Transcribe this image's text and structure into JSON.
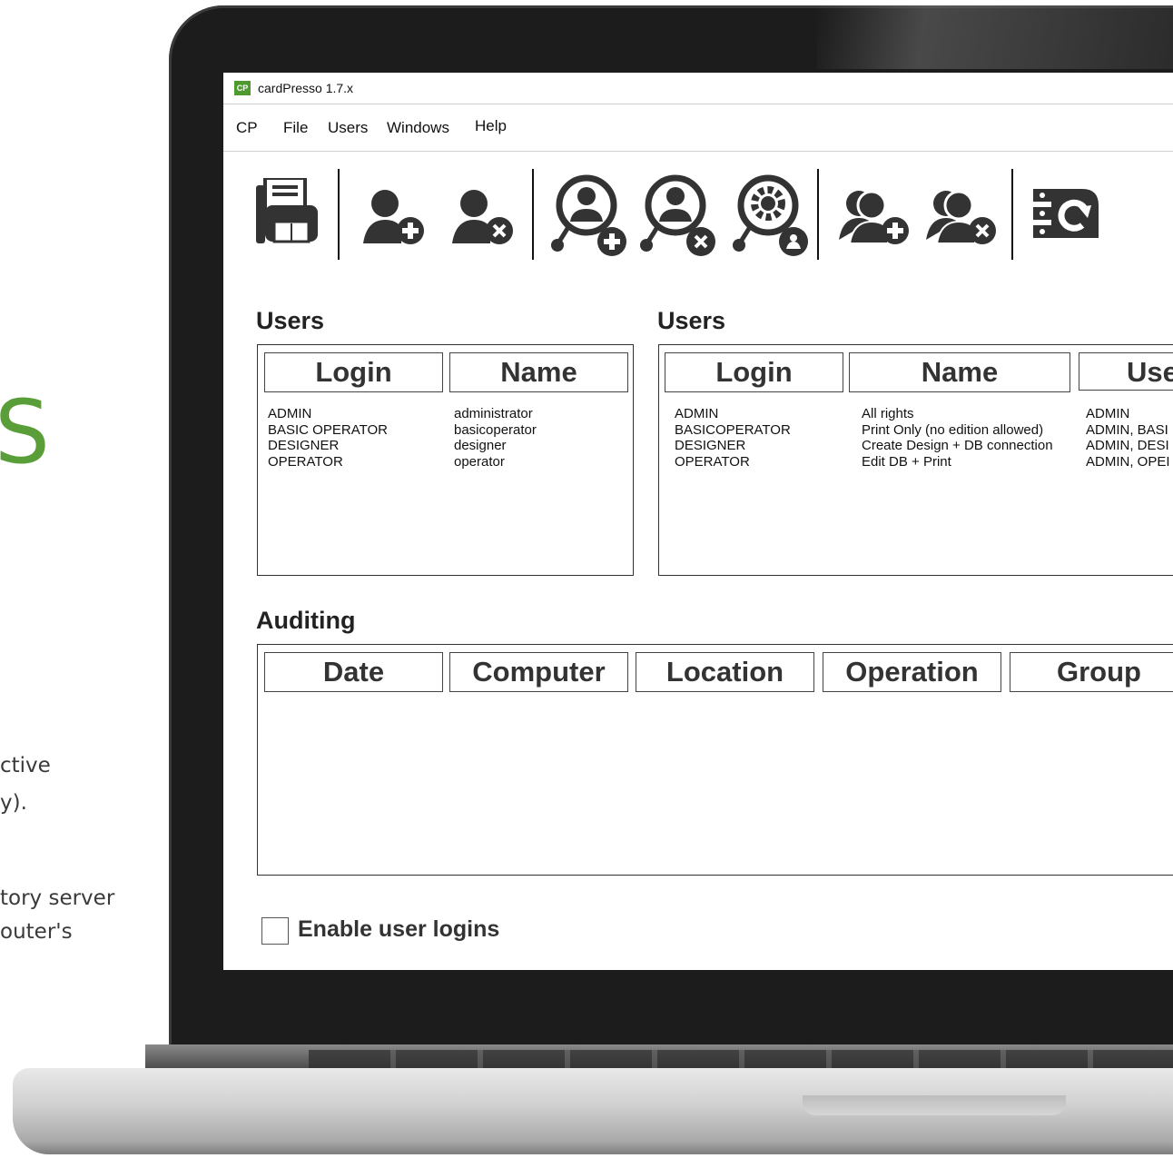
{
  "background_page": {
    "heading_fragment": "S",
    "lines": [
      "ctive",
      "y).",
      "tory server",
      "outer's"
    ]
  },
  "window": {
    "title": "cardPresso 1.7.x",
    "logo": "CP"
  },
  "menu": {
    "items": [
      "CP",
      "File",
      "Users",
      "Windows",
      "Help"
    ]
  },
  "toolbar": {
    "icons": [
      "printer-icon",
      "add-user-icon",
      "remove-user-icon",
      "add-network-user-icon",
      "remove-network-user-icon",
      "network-user-settings-icon",
      "add-group-icon",
      "remove-group-icon",
      "database-sync-icon"
    ]
  },
  "users_panel": {
    "title": "Users",
    "columns": [
      "Login",
      "Name"
    ],
    "logins": [
      "ADMIN",
      "BASIC OPERATOR",
      "DESIGNER",
      "OPERATOR"
    ],
    "names": [
      "administrator",
      "basicoperator",
      "designer",
      "operator"
    ]
  },
  "groups_panel": {
    "title": "Users",
    "columns": [
      "Login",
      "Name",
      "Use"
    ],
    "logins": [
      "ADMIN",
      "BASICOPERATOR",
      "DESIGNER",
      "OPERATOR"
    ],
    "names": [
      "All rights",
      "Print Only (no edition allowed)",
      "Create Design + DB connection",
      "Edit DB + Print"
    ],
    "users": [
      "ADMIN",
      "ADMIN, BASI",
      "ADMIN, DESI",
      "ADMIN, OPEI"
    ]
  },
  "auditing": {
    "title": "Auditing",
    "columns": [
      "Date",
      "Computer",
      "Location",
      "Operation",
      "Group"
    ]
  },
  "enable_logins": {
    "label": "Enable user logins",
    "checked": false
  },
  "colors": {
    "accent_green": "#5a9e3a",
    "logo_green": "#4f9a2f",
    "icon_dark": "#333333"
  }
}
